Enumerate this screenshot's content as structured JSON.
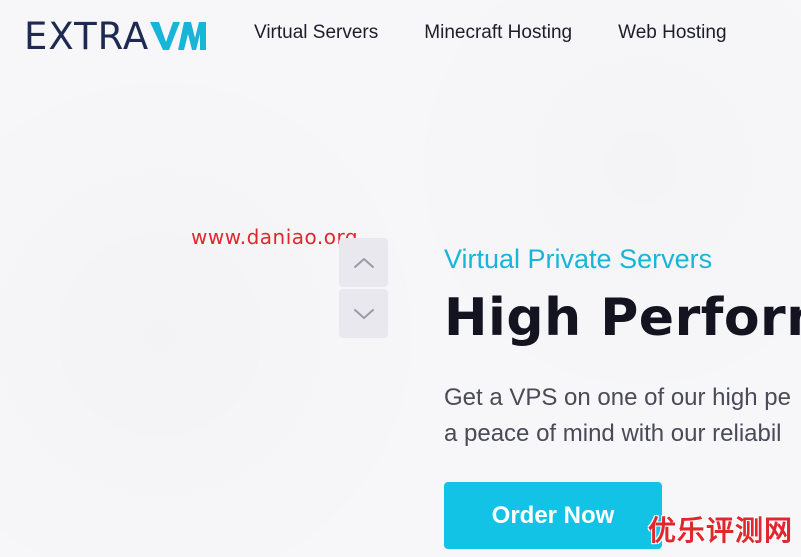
{
  "header": {
    "logo_text": "EXTRA",
    "logo_mark_text": "VM",
    "nav": [
      {
        "label": "Virtual Servers"
      },
      {
        "label": "Minecraft Hosting"
      },
      {
        "label": "Web Hosting"
      }
    ]
  },
  "watermark": {
    "url_text": "www.daniao.org",
    "corner_text": "优乐评测网"
  },
  "carousel": {
    "up_icon": "chevron-up-icon",
    "down_icon": "chevron-down-icon"
  },
  "hero": {
    "eyebrow": "Virtual Private Servers",
    "title": "High Performa",
    "desc_line1": "Get a VPS on one of our high pe",
    "desc_line2": "a peace of mind with our reliabil",
    "cta_label": "Order Now"
  },
  "colors": {
    "brand_navy": "#1e2a52",
    "brand_cyan": "#19b5d9",
    "button_bg": "#12c3e6",
    "watermark_red": "#e0272d"
  }
}
